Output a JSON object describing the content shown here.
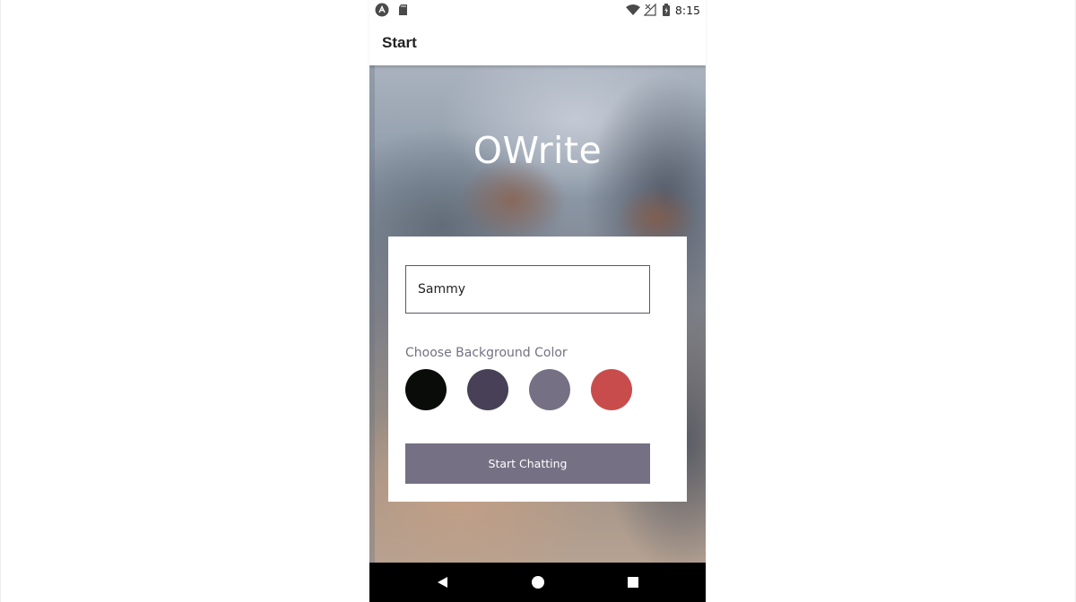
{
  "status_bar": {
    "time": "8:15",
    "left_icons": [
      "app-notification-icon",
      "sd-card-icon"
    ],
    "right_icons": [
      "wifi-icon",
      "no-signal-icon",
      "battery-charging-icon"
    ]
  },
  "action_bar": {
    "title": "Start"
  },
  "app": {
    "title": "OWrite"
  },
  "form": {
    "name_value": "Sammy",
    "color_label": "Choose Background Color",
    "colors": [
      "#090C08",
      "#474056",
      "#757083",
      "#C94C4C"
    ],
    "button_label": "Start Chatting",
    "button_color": "#757083"
  },
  "nav_bar": {
    "icons": [
      "back-icon",
      "home-icon",
      "recents-icon"
    ]
  }
}
